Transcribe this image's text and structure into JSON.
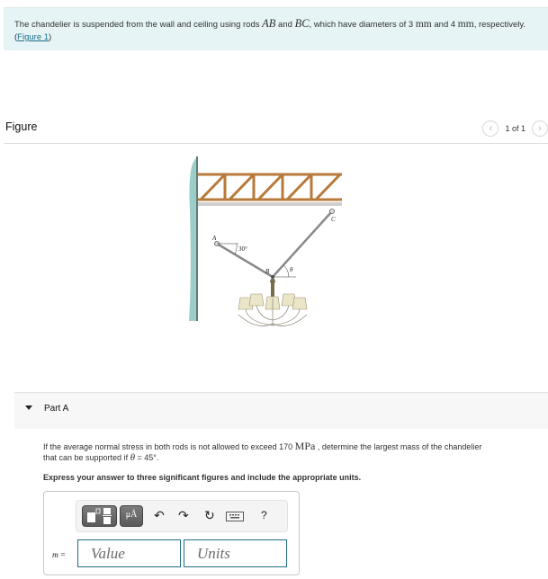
{
  "intro": {
    "text_1": "The chandelier is suspended from the wall and ceiling using rods ",
    "rod_1": "AB",
    "text_2": " and ",
    "rod_2": "BC",
    "text_3": ", which have diameters of 3 ",
    "unit_1": "mm",
    "text_4": " and 4 ",
    "unit_2": "mm",
    "text_5": ", respectively. (",
    "figure_link": "Figure 1",
    "text_6": ")"
  },
  "figure": {
    "title": "Figure",
    "counter": "1 of 1",
    "prev_icon": "chevron-left-icon",
    "next_icon": "chevron-right-icon",
    "labels": {
      "a": "A",
      "b": "B",
      "c": "C",
      "angle_ab": "30°",
      "theta": "θ"
    },
    "colors": {
      "wall": "#9ccdc6",
      "truss": "#b87a3a",
      "rod": "#8a8a8a",
      "ceiling": "#c9c9c9"
    }
  },
  "part": {
    "label": "Part A",
    "question_1": "If the average normal stress in both rods is not allowed to exceed 170 ",
    "question_unit": "MPa",
    "question_2": " , determine the largest mass of the chandelier",
    "question_3": "that can be supported if ",
    "theta": "θ",
    "question_4": " = 45°.",
    "instruction": "Express your answer to three significant figures and include the appropriate units."
  },
  "answer": {
    "toolbar": {
      "template_icon": "fraction-template-icon",
      "units_label": "μÅ",
      "undo_icon": "undo-icon",
      "redo_icon": "redo-icon",
      "reset_icon": "reset-icon",
      "keyboard_icon": "keyboard-icon",
      "help_label": "?"
    },
    "variable": "m",
    "equals": " =",
    "value_placeholder": "Value",
    "units_placeholder": "Units",
    "value": "",
    "units": ""
  }
}
